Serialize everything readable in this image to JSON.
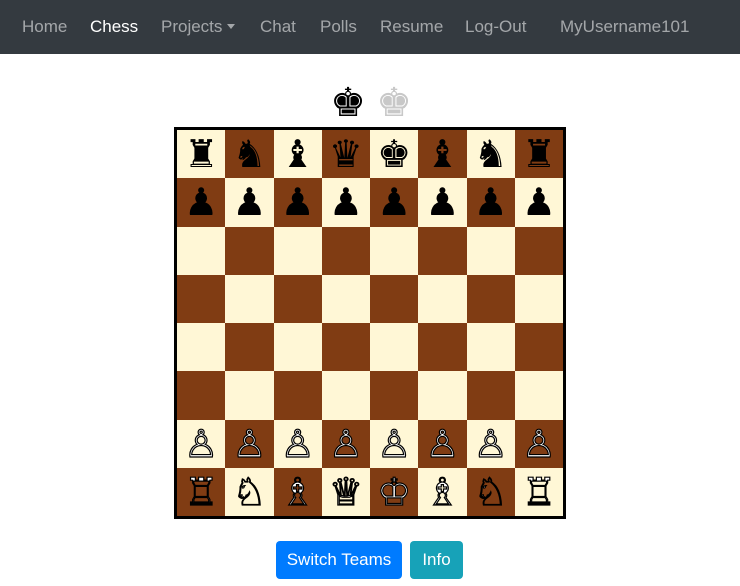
{
  "navbar": {
    "items": [
      {
        "label": "Home",
        "active": false
      },
      {
        "label": "Chess",
        "active": true
      },
      {
        "label": "Projects",
        "active": false,
        "dropdown": true
      },
      {
        "label": "Chat",
        "active": false
      },
      {
        "label": "Polls",
        "active": false
      },
      {
        "label": "Resume",
        "active": false
      },
      {
        "label": "Log-Out",
        "active": false
      }
    ],
    "username": "MyUsername101",
    "colors": {
      "background": "#343a40",
      "link": "rgba(255,255,255,0.55)",
      "active": "#ffffff"
    }
  },
  "team_selector": {
    "black_king": "♚",
    "white_king": "♚",
    "selected": "black"
  },
  "board": {
    "light_color": "#fff7d6",
    "dark_color": "#803c13",
    "ranks": [
      [
        "♜",
        "♞",
        "♝",
        "♛",
        "♚",
        "♝",
        "♞",
        "♜"
      ],
      [
        "♟",
        "♟",
        "♟",
        "♟",
        "♟",
        "♟",
        "♟",
        "♟"
      ],
      [
        "",
        "",
        "",
        "",
        "",
        "",
        "",
        ""
      ],
      [
        "",
        "",
        "",
        "",
        "",
        "",
        "",
        ""
      ],
      [
        "",
        "",
        "",
        "",
        "",
        "",
        "",
        ""
      ],
      [
        "",
        "",
        "",
        "",
        "",
        "",
        "",
        ""
      ],
      [
        "♙",
        "♙",
        "♙",
        "♙",
        "♙",
        "♙",
        "♙",
        "♙"
      ],
      [
        "♖",
        "♘",
        "♗",
        "♕",
        "♔",
        "♗",
        "♘",
        "♖"
      ]
    ]
  },
  "buttons": {
    "switch_teams": "Switch Teams",
    "info": "Info",
    "colors": {
      "primary": "#007bff",
      "info": "#17a2b8"
    }
  }
}
